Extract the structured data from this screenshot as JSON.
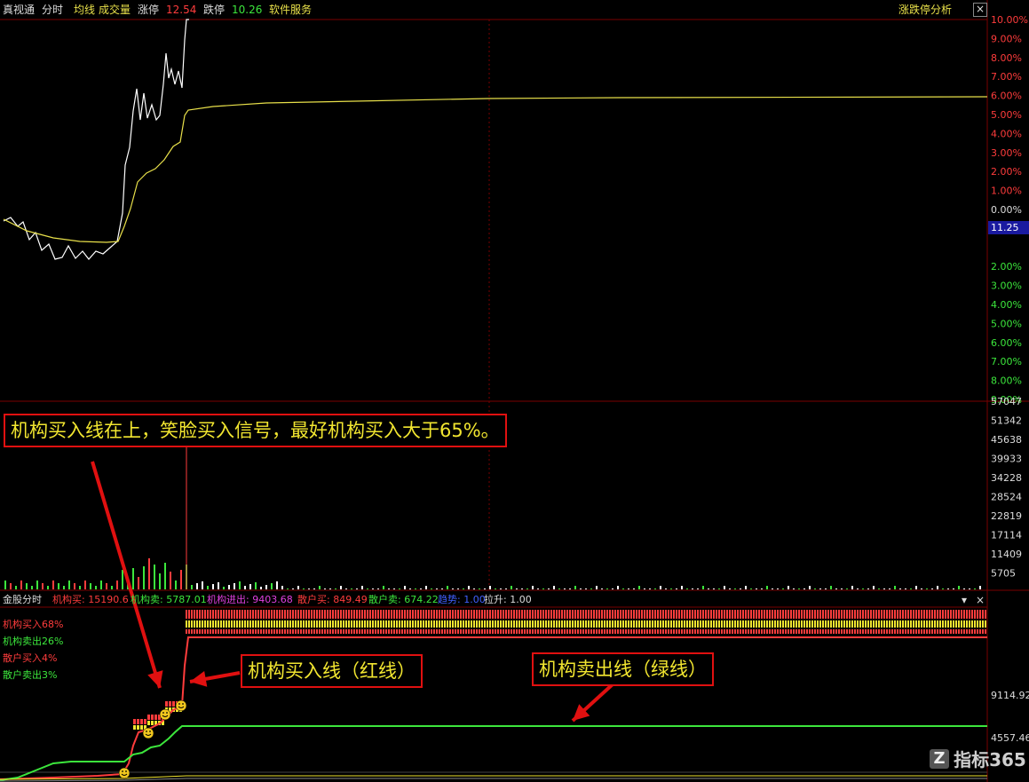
{
  "header": {
    "items": [
      {
        "text": "真视通",
        "color": "#dddddd"
      },
      {
        "text": "分时",
        "color": "#dddddd"
      },
      {
        "text": "均线",
        "color": "#e8e04a"
      },
      {
        "text": "成交量",
        "color": "#e8e04a"
      },
      {
        "text": "涨停",
        "color": "#dddddd"
      },
      {
        "text": "12.54",
        "color": "#ff3c3c"
      },
      {
        "text": "跌停",
        "color": "#dddddd"
      },
      {
        "text": "10.26",
        "color": "#3ce63c"
      },
      {
        "text": "软件服务",
        "color": "#e8e04a"
      }
    ],
    "right_label": "涨跌停分析",
    "close_glyph": "×"
  },
  "price_axis": {
    "up_labels": [
      "10.00%",
      "9.00%",
      "8.00%",
      "7.00%",
      "6.00%",
      "5.00%",
      "4.00%",
      "3.00%",
      "2.00%",
      "1.00%"
    ],
    "zero_label": "0.00%",
    "current_price": "11.25",
    "down_labels": [
      "2.00%",
      "3.00%",
      "4.00%",
      "5.00%",
      "6.00%",
      "7.00%",
      "8.00%",
      "9.00%"
    ]
  },
  "volume_axis": {
    "labels": [
      "57047",
      "51342",
      "45638",
      "39933",
      "34228",
      "28524",
      "22819",
      "17114",
      "11409",
      "5705"
    ]
  },
  "indicator": {
    "items": [
      {
        "text": "金股分时",
        "color": "#dddddd"
      },
      {
        "text": "机构买: 15190.6",
        "color": "#ff3c3c"
      },
      {
        "text": "机构卖: 5787.01",
        "color": "#3ce63c"
      },
      {
        "text": "机构进出: 9403.68",
        "color": "#e040e0"
      },
      {
        "text": "散户买: 849.49",
        "color": "#ff3c3c"
      },
      {
        "text": "散户卖: 674.22",
        "color": "#3ce63c"
      },
      {
        "text": "趋势: 1.00",
        "color": "#4060ff"
      },
      {
        "text": "拉升: 1.00",
        "color": "#dddddd"
      }
    ],
    "pct_labels": [
      {
        "text": "机构买入68%",
        "color": "#ff3c3c"
      },
      {
        "text": "机构卖出26%",
        "color": "#3ce63c"
      },
      {
        "text": "散户买入4%",
        "color": "#ff3c3c"
      },
      {
        "text": "散户卖出3%",
        "color": "#3ce63c"
      }
    ],
    "axis_labels": [
      "9114.92",
      "4557.46"
    ],
    "dropdown_glyph": "▾",
    "close_glyph": "×"
  },
  "annotations": {
    "top": "机构买入线在上，笑脸买入信号，最好机构买入大于65%。",
    "red_line": "机构买入线（红线）",
    "green_line": "机构卖出线（绿线）"
  },
  "watermark": {
    "mark": "Z",
    "text": "指标365"
  },
  "colors": {
    "background": "#000000",
    "up": "#ff3c3c",
    "down": "#3ce63c",
    "price_line": "#ffffff",
    "avg_line": "#e8e04a",
    "grid": "#7a0000",
    "highlight": "#1a1aa0",
    "annotation_border": "#e01010",
    "annotation_text": "#f2e630"
  }
}
